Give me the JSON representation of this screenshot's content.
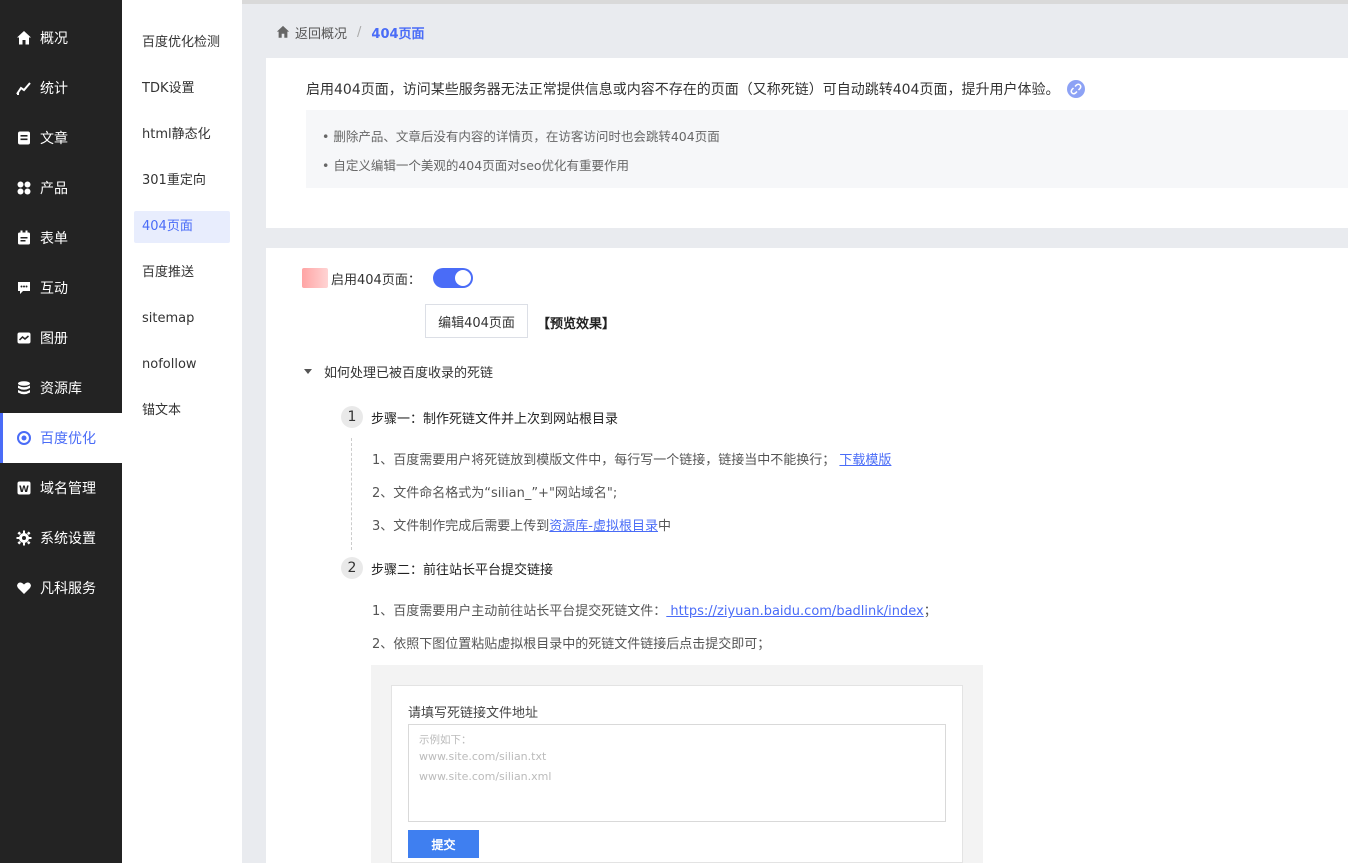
{
  "nav": {
    "items": [
      {
        "label": "概况",
        "icon": "home-icon"
      },
      {
        "label": "统计",
        "icon": "stats-icon"
      },
      {
        "label": "文章",
        "icon": "article-icon"
      },
      {
        "label": "产品",
        "icon": "product-icon"
      },
      {
        "label": "表单",
        "icon": "form-icon"
      },
      {
        "label": "互动",
        "icon": "chat-icon"
      },
      {
        "label": "图册",
        "icon": "album-icon"
      },
      {
        "label": "资源库",
        "icon": "database-icon"
      },
      {
        "label": "百度优化",
        "icon": "seo-icon",
        "active": true
      },
      {
        "label": "域名管理",
        "icon": "domain-icon"
      },
      {
        "label": "系统设置",
        "icon": "gear-icon"
      },
      {
        "label": "凡科服务",
        "icon": "heart-icon"
      }
    ]
  },
  "subnav": {
    "items": [
      {
        "label": "百度优化检测"
      },
      {
        "label": "TDK设置"
      },
      {
        "label": "html静态化"
      },
      {
        "label": "301重定向"
      },
      {
        "label": "404页面",
        "active": true
      },
      {
        "label": "百度推送"
      },
      {
        "label": "sitemap"
      },
      {
        "label": "nofollow"
      },
      {
        "label": "锚文本"
      }
    ]
  },
  "breadcrumb": {
    "back": "返回概况",
    "separator": "/",
    "current": "404页面"
  },
  "intro": {
    "text": "启用404页面，访问某些服务器无法正常提供信息或内容不存在的页面（又称死链）可自动跳转404页面，提升用户体验。",
    "notes": [
      "• 删除产品、文章后没有内容的详情页，在访客访问时也会跳转404页面",
      "• 自定义编辑一个美观的404页面对seo优化有重要作用"
    ]
  },
  "settings": {
    "enable_label": "启用404页面：",
    "enabled": true,
    "edit_button": "编辑404页面",
    "preview_link": "【预览效果】"
  },
  "guide": {
    "title": "如何处理已被百度收录的死链",
    "step1": {
      "num": "1",
      "title": "步骤一：制作死链文件并上次到网站根目录",
      "line1_text": "1、百度需要用户将死链放到模版文件中，每行写一个链接，链接当中不能换行；",
      "line1_link": "下载模版",
      "line2_text": "2、文件命名格式为“silian_”+\"网站域名\";",
      "line3_text": "3、文件制作完成后需要上传到",
      "line3_link": "资源库-虚拟根目录",
      "line3_suffix": "中"
    },
    "step2": {
      "num": "2",
      "title": "步骤二：前往站长平台提交链接",
      "line1_text": "1、百度需要用户主动前往站长平台提交死链文件：",
      "line1_link": " https://ziyuan.baidu.com/badlink/index",
      "line1_suffix": "；",
      "line2_text": "2、依照下图位置粘贴虚拟根目录中的死链文件链接后点击提交即可；"
    }
  },
  "demo": {
    "label": "请填写死链接文件地址",
    "placeholder_head": "示例如下：",
    "placeholder_line1": "www.site.com/silian.txt",
    "placeholder_line2": "www.site.com/silian.xml",
    "submit": "提交"
  },
  "colors": {
    "accent": "#4a6cf7",
    "nav_bg": "#232323",
    "submit": "#3f7ff0"
  }
}
